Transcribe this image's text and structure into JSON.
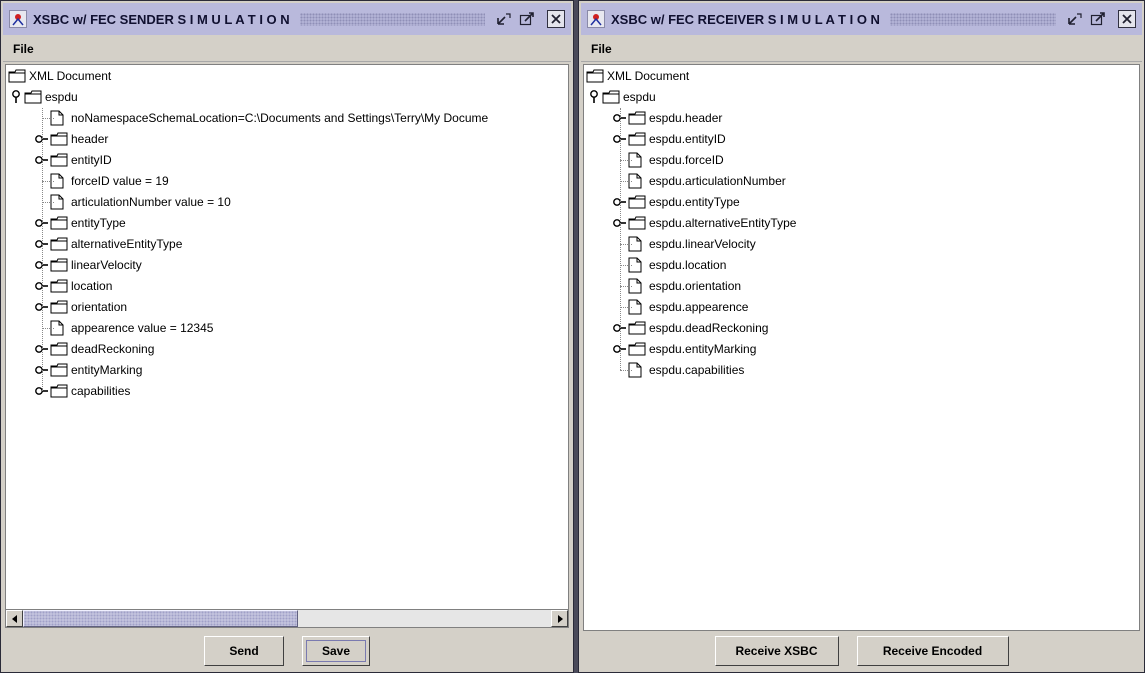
{
  "colors": {
    "titlebar": "#b9b9dc",
    "window_bg": "#d4d0c8",
    "tree_bg": "#ffffff",
    "folder_fill": "#ffffff",
    "folder_stroke": "#000000"
  },
  "sender": {
    "title": "XSBC w/ FEC SENDER  S I M U L A T I O N",
    "menu": [
      "File"
    ],
    "root_label": "XML Document",
    "espdu_label": "espdu",
    "items": [
      {
        "label": "noNamespaceSchemaLocation=C:\\Documents and Settings\\Terry\\My Docume",
        "icon": "file-icon",
        "expandable": false
      },
      {
        "label": "header",
        "icon": "folder-icon",
        "expandable": true
      },
      {
        "label": "entityID",
        "icon": "folder-icon",
        "expandable": true
      },
      {
        "label": "forceID value = 19",
        "icon": "file-icon",
        "expandable": false
      },
      {
        "label": "articulationNumber value = 10",
        "icon": "file-icon",
        "expandable": false
      },
      {
        "label": "entityType",
        "icon": "folder-icon",
        "expandable": true
      },
      {
        "label": "alternativeEntityType",
        "icon": "folder-icon",
        "expandable": true
      },
      {
        "label": "linearVelocity",
        "icon": "folder-icon",
        "expandable": true
      },
      {
        "label": "location",
        "icon": "folder-icon",
        "expandable": true
      },
      {
        "label": "orientation",
        "icon": "folder-icon",
        "expandable": true
      },
      {
        "label": "appearence value = 12345",
        "icon": "file-icon",
        "expandable": false
      },
      {
        "label": "deadReckoning",
        "icon": "folder-icon",
        "expandable": true
      },
      {
        "label": "entityMarking",
        "icon": "folder-icon",
        "expandable": true
      },
      {
        "label": "capabilities",
        "icon": "folder-icon",
        "expandable": true
      }
    ],
    "buttons": {
      "send": "Send",
      "save": "Save"
    }
  },
  "receiver": {
    "title": "XSBC w/ FEC RECEIVER  S I M U L A T I O N",
    "menu": [
      "File"
    ],
    "root_label": "XML Document",
    "espdu_label": "espdu",
    "items": [
      {
        "label": "espdu.header",
        "icon": "folder-icon",
        "expandable": true
      },
      {
        "label": "espdu.entityID",
        "icon": "folder-icon",
        "expandable": true
      },
      {
        "label": "espdu.forceID",
        "icon": "file-icon",
        "expandable": false
      },
      {
        "label": "espdu.articulationNumber",
        "icon": "file-icon",
        "expandable": false
      },
      {
        "label": "espdu.entityType",
        "icon": "folder-icon",
        "expandable": true
      },
      {
        "label": "espdu.alternativeEntityType",
        "icon": "folder-icon",
        "expandable": true
      },
      {
        "label": "espdu.linearVelocity",
        "icon": "file-icon",
        "expandable": false
      },
      {
        "label": "espdu.location",
        "icon": "file-icon",
        "expandable": false
      },
      {
        "label": "espdu.orientation",
        "icon": "file-icon",
        "expandable": false
      },
      {
        "label": "espdu.appearence",
        "icon": "file-icon",
        "expandable": false
      },
      {
        "label": "espdu.deadReckoning",
        "icon": "folder-icon",
        "expandable": true
      },
      {
        "label": "espdu.entityMarking",
        "icon": "folder-icon",
        "expandable": true
      },
      {
        "label": "espdu.capabilities",
        "icon": "file-icon",
        "expandable": false
      }
    ],
    "buttons": {
      "receive_xsbc": "Receive XSBC",
      "receive_encoded": "Receive Encoded"
    }
  }
}
